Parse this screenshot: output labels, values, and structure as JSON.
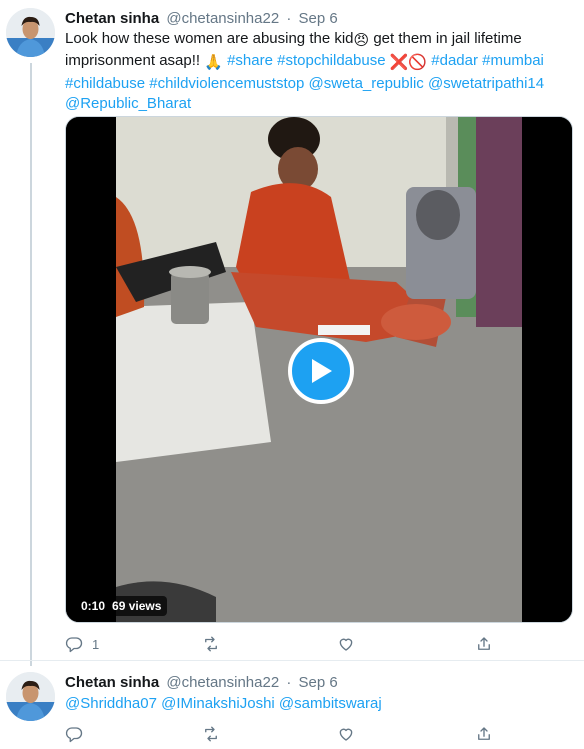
{
  "tweets": [
    {
      "author_name": "Chetan sinha",
      "handle": "@chetansinha22",
      "separator": "·",
      "date": "Sep 6",
      "text": {
        "main": "Look how these women are abusing the kid",
        "emoji_angry": "😠",
        "after_emoji": " get them in jail lifetime imprisonment asap!! ",
        "emoji_pray": "🙏",
        "tags": [
          "#share",
          "#stopchildabuse"
        ],
        "emoji_x": "❌",
        "emoji_prohibited": "🚫",
        "tags2": [
          "#dadar",
          "#mumbai",
          "#childabuse",
          "#childviolencemuststop"
        ],
        "mentions": [
          "@sweta_republic",
          "@swetatripathi14",
          "@Republic_Bharat"
        ]
      },
      "video": {
        "duration": "0:10",
        "views": "69 views"
      },
      "actions": {
        "reply_count": "1",
        "retweet_count": "",
        "like_count": ""
      }
    },
    {
      "author_name": "Chetan sinha",
      "handle": "@chetansinha22",
      "separator": "·",
      "date": "Sep 6",
      "mentions": [
        "@Shriddha07",
        "@IMinakshiJoshi",
        "@sambitswaraj"
      ]
    }
  ],
  "colors": {
    "accent": "#1da1f2",
    "text": "#14171a",
    "muted": "#657786",
    "thread_line": "#ccd6dd"
  },
  "icons": [
    "reply-icon",
    "retweet-icon",
    "like-icon",
    "share-icon",
    "play-icon"
  ]
}
